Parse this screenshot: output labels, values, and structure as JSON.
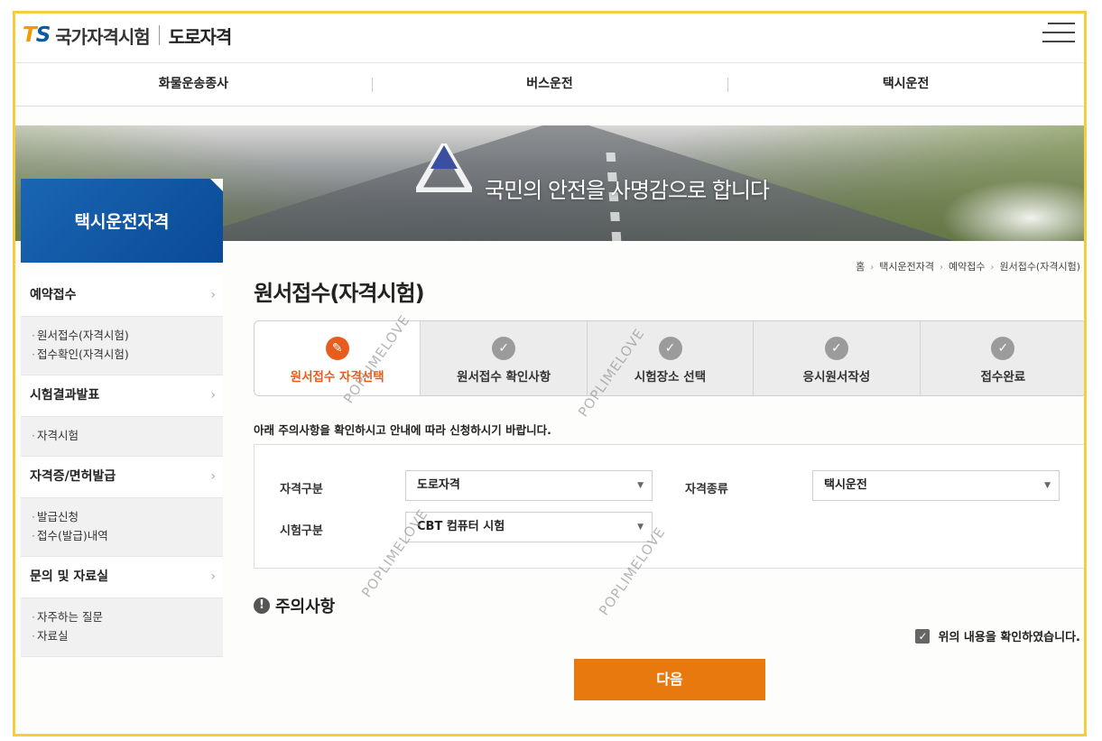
{
  "header": {
    "logo_ts_t": "T",
    "logo_ts_s": "S",
    "logo_name": "국가자격시험",
    "logo_sub": "도로자격"
  },
  "topnav": [
    "화물운송종사",
    "버스운전",
    "택시운전"
  ],
  "banner": {
    "slogan": "국민의 안전을 사명감으로 합니다"
  },
  "sidebar": {
    "title": "택시운전자격",
    "groups": [
      {
        "label": "예약접수",
        "items": [
          "원서접수(자격시험)",
          "접수확인(자격시험)"
        ]
      },
      {
        "label": "시험결과발표",
        "items": [
          "자격시험"
        ]
      },
      {
        "label": "자격증/면허발급",
        "items": [
          "발급신청",
          "접수(발급)내역"
        ]
      },
      {
        "label": "문의 및 자료실",
        "items": [
          "자주하는 질문",
          "자료실"
        ]
      }
    ],
    "chevron": "›"
  },
  "breadcrumb": [
    "홈",
    "택시운전자격",
    "예약접수",
    "원서접수(자격시험)"
  ],
  "page_title": "원서접수(자격시험)",
  "steps": [
    {
      "label": "원서접수 자격선택",
      "state": "current"
    },
    {
      "label": "원서접수 확인사항",
      "state": "done"
    },
    {
      "label": "시험장소 선택",
      "state": "done"
    },
    {
      "label": "응시원서작성",
      "state": "done"
    },
    {
      "label": "접수완료",
      "state": "done"
    }
  ],
  "notice": "아래 주의사항을 확인하시고 안내에 따라 신청하시기 바랍니다.",
  "form": {
    "qual_type_label": "자격구분",
    "qual_type_value": "도로자격",
    "qual_kind_label": "자격종류",
    "qual_kind_value": "택시운전",
    "exam_type_label": "시험구분",
    "exam_type_value": "CBT 컴퓨터 시험"
  },
  "caution": {
    "icon": "!",
    "title": "주의사항"
  },
  "agree": {
    "label": "위의 내용을 확인하였습니다.",
    "checked": true
  },
  "next_button": "다음",
  "watermark": "POPLIMELOVE",
  "colors": {
    "accent": "#e8790f",
    "current_step": "#e85d1e",
    "sidebar_title": "#0a4a96",
    "frame": "#f2cf3e"
  }
}
